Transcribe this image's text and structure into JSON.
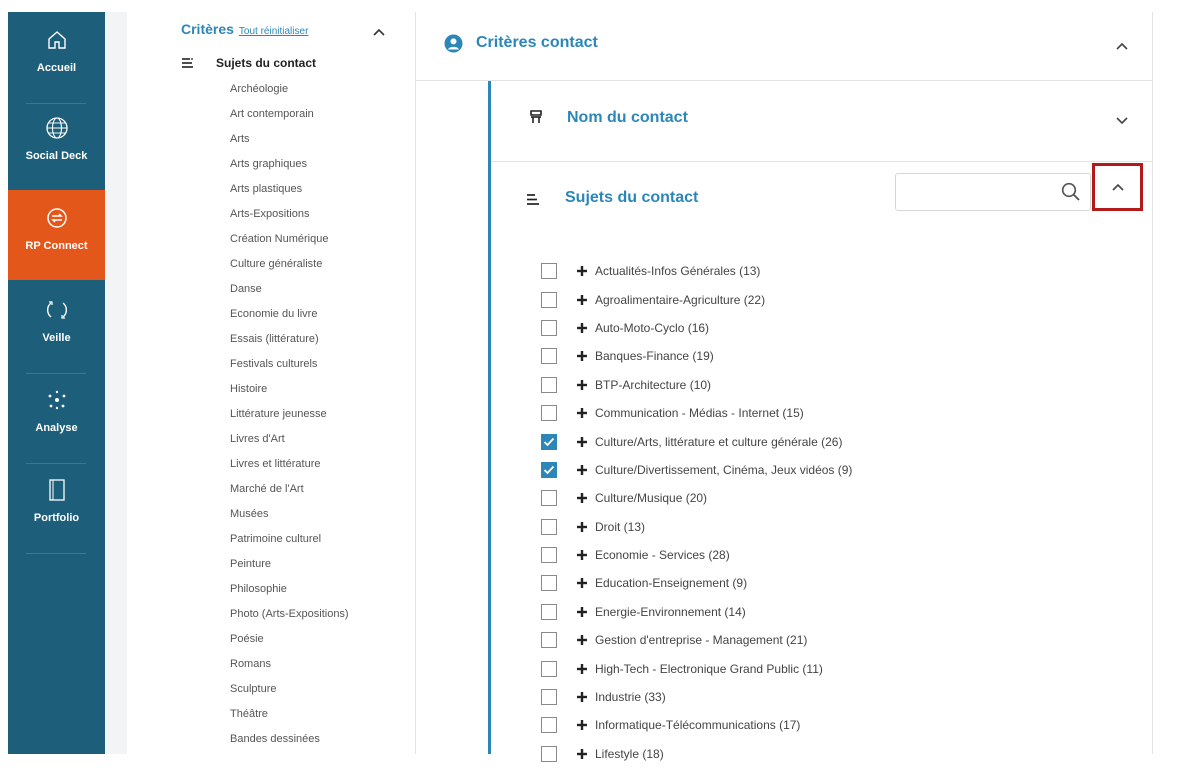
{
  "nav": {
    "items": [
      {
        "label": "Accueil",
        "icon": "home-icon"
      },
      {
        "label": "Social Deck",
        "icon": "globe-icon"
      },
      {
        "label": "RP Connect",
        "icon": "connect-icon"
      },
      {
        "label": "Veille",
        "icon": "refresh-icon"
      },
      {
        "label": "Analyse",
        "icon": "network-icon"
      },
      {
        "label": "Portfolio",
        "icon": "book-icon"
      }
    ],
    "active_color": "#e4571b",
    "bg_color": "#1d5f7a"
  },
  "criteria": {
    "title": "Critères",
    "reset_label": "Tout réinitialiser",
    "subjects_heading": "Sujets du contact",
    "items": [
      "Archéologie",
      "Art contemporain",
      "Arts",
      "Arts graphiques",
      "Arts plastiques",
      "Arts-Expositions",
      "Création Numérique",
      "Culture généraliste",
      "Danse",
      "Economie du livre",
      "Essais (littérature)",
      "Festivals culturels",
      "Histoire",
      "Littérature jeunesse",
      "Livres d'Art",
      "Livres et littérature",
      "Marché de l'Art",
      "Musées",
      "Patrimoine culturel",
      "Peinture",
      "Philosophie",
      "Photo (Arts-Expositions)",
      "Poésie",
      "Romans",
      "Sculpture",
      "Théâtre",
      "Bandes dessinées"
    ]
  },
  "panel": {
    "title": "Critères contact",
    "nom_title": "Nom du contact",
    "sujets_title": "Sujets du contact",
    "search_placeholder": "",
    "accent_color": "#2c87b8",
    "topics": [
      {
        "label": "Actualités-Infos Générales (13)",
        "checked": false
      },
      {
        "label": "Agroalimentaire-Agriculture (22)",
        "checked": false
      },
      {
        "label": "Auto-Moto-Cyclo (16)",
        "checked": false
      },
      {
        "label": "Banques-Finance (19)",
        "checked": false
      },
      {
        "label": "BTP-Architecture (10)",
        "checked": false
      },
      {
        "label": "Communication - Médias - Internet (15)",
        "checked": false
      },
      {
        "label": "Culture/Arts, littérature et culture générale (26)",
        "checked": true
      },
      {
        "label": "Culture/Divertissement, Cinéma, Jeux vidéos (9)",
        "checked": true
      },
      {
        "label": "Culture/Musique (20)",
        "checked": false
      },
      {
        "label": "Droit (13)",
        "checked": false
      },
      {
        "label": "Economie - Services (28)",
        "checked": false
      },
      {
        "label": "Education-Enseignement (9)",
        "checked": false
      },
      {
        "label": "Energie-Environnement (14)",
        "checked": false
      },
      {
        "label": "Gestion d'entreprise - Management (21)",
        "checked": false
      },
      {
        "label": "High-Tech - Electronique Grand Public (11)",
        "checked": false
      },
      {
        "label": "Industrie (33)",
        "checked": false
      },
      {
        "label": "Informatique-Télécommunications (17)",
        "checked": false
      },
      {
        "label": "Lifestyle (18)",
        "checked": false
      }
    ]
  }
}
